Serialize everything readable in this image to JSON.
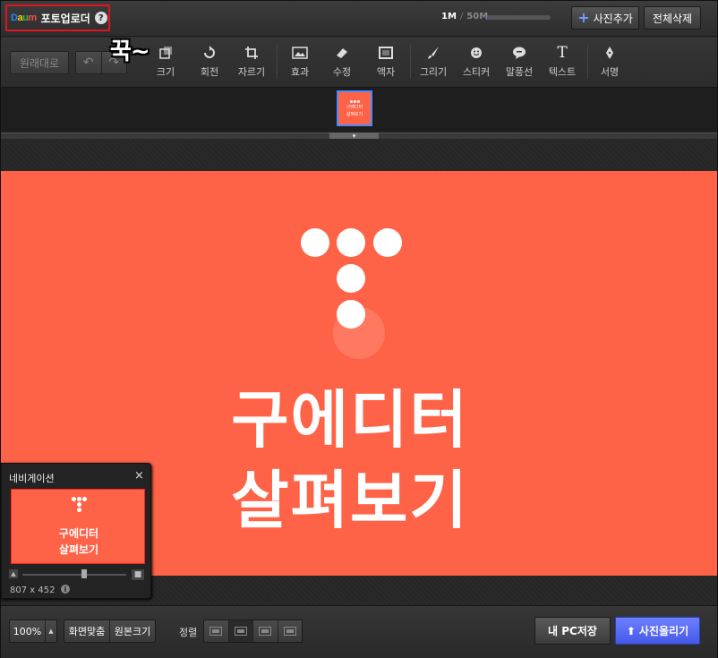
{
  "header": {
    "logo_letters": [
      "D",
      "a",
      "u",
      "m"
    ],
    "app_title": "포토업로더",
    "help_symbol": "?",
    "capacity_used": "1M",
    "capacity_separator": "/",
    "capacity_max": "50M",
    "capacity_fill": 0.02,
    "add_photo_label": "사진추가",
    "delete_all_label": "전체삭제"
  },
  "toolbar": {
    "original_label": "원래대로",
    "undo_symbol": "↶",
    "redo_symbol": "↷",
    "tools": [
      {
        "label": "크기",
        "icon": "resize-icon"
      },
      {
        "label": "회전",
        "icon": "rotate-icon"
      },
      {
        "label": "자르기",
        "icon": "crop-icon"
      },
      {
        "label": "효과",
        "icon": "effect-icon"
      },
      {
        "label": "수정",
        "icon": "eraser-icon"
      },
      {
        "label": "액자",
        "icon": "frame-icon"
      },
      {
        "label": "그리기",
        "icon": "brush-icon"
      },
      {
        "label": "스티커",
        "icon": "smiley-icon"
      },
      {
        "label": "말풍선",
        "icon": "speech-bubble-icon"
      },
      {
        "label": "텍스트",
        "icon": "text-icon"
      },
      {
        "label": "서명",
        "icon": "pen-nib-icon"
      }
    ],
    "annotation_sticker": "꾹~"
  },
  "thumbnail": {
    "line1": "구에디터",
    "line2": "살펴보기",
    "expand_symbol": "▾"
  },
  "canvas": {
    "line1": "구에디터",
    "line2": "살펴보기",
    "background_color": "#ff6347"
  },
  "navigator": {
    "title": "네비게이션",
    "close_symbol": "×",
    "preview_line1": "구에디터",
    "preview_line2": "살펴보기",
    "zoom_level_fraction": 0.6,
    "image_size": "807 x 452",
    "info_symbol": "i"
  },
  "bottom": {
    "zoom_value": "100%",
    "zoom_arrow": "▲",
    "fit_screen_label": "화면맞춤",
    "original_size_label": "원본크기",
    "align_label": "정렬",
    "save_pc_label": "내 PC저장",
    "upload_label": "사진올리기",
    "upload_arrow": "⬆",
    "accent_color": "#4659e8"
  }
}
